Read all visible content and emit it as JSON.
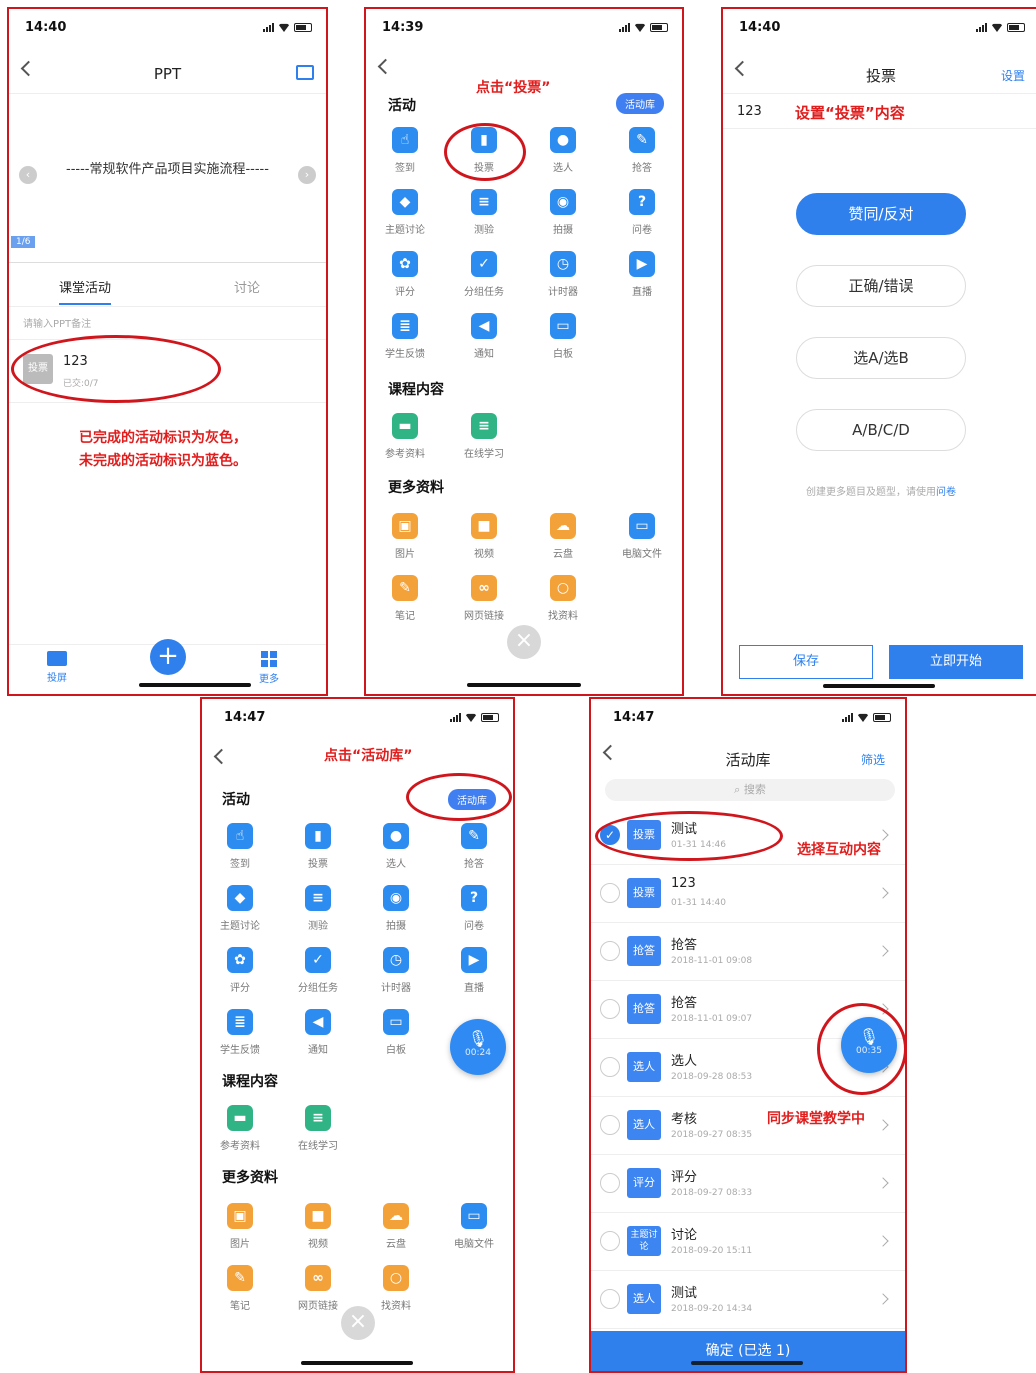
{
  "phone1": {
    "time": "14:40",
    "title": "PPT",
    "slide_text": "-----常规软件产品项目实施流程-----",
    "page_indicator": "1/6",
    "tabs": [
      "课堂活动",
      "讨论"
    ],
    "note_placeholder": "请输入PPT备注",
    "activity": {
      "tag": "投票",
      "name": "123",
      "sub": "已交:0/7"
    },
    "annotation_line1": "已完成的活动标识为灰色，",
    "annotation_line2": "未完成的活动标识为蓝色。",
    "bottom": {
      "left": "投屏",
      "right": "更多"
    }
  },
  "phone2": {
    "time": "14:39",
    "annotation": "点击“投票”",
    "library_button": "活动库",
    "section_activity": "活动",
    "activities": [
      "签到",
      "投票",
      "选人",
      "抢答",
      "主题讨论",
      "测验",
      "拍摄",
      "问卷",
      "评分",
      "分组任务",
      "计时器",
      "直播",
      "学生反馈",
      "通知",
      "白板"
    ],
    "section_course": "课程内容",
    "course_items": [
      "参考资料",
      "在线学习"
    ],
    "section_more": "更多资料",
    "more_items": [
      "图片",
      "视频",
      "云盘",
      "电脑文件",
      "笔记",
      "网页链接",
      "找资料"
    ]
  },
  "phone3": {
    "time": "14:40",
    "title": "投票",
    "settings": "设置",
    "input_value": "123",
    "annotation": "设置“投票”内容",
    "options": [
      "赞同/反对",
      "正确/错误",
      "选A/选B",
      "A/B/C/D"
    ],
    "hint_prefix": "创建更多题目及题型，请使用",
    "hint_link": "问卷",
    "save": "保存",
    "start": "立即开始"
  },
  "phone4": {
    "time": "14:47",
    "annotation": "点击“活动库”",
    "mic_time": "00:24",
    "more_items_partial": [
      "笔记",
      "网页链接",
      "找资料"
    ]
  },
  "phone5": {
    "time": "14:47",
    "title": "活动库",
    "filter": "筛选",
    "search_placeholder": "搜索",
    "annotation_select": "选择互动内容",
    "annotation_sync": "同步课堂教学中",
    "mic_time": "00:35",
    "rows": [
      {
        "tag": "投票",
        "name": "测试",
        "date": "01-31 14:46",
        "checked": true
      },
      {
        "tag": "投票",
        "name": "123",
        "date": "01-31 14:40",
        "checked": false
      },
      {
        "tag": "抢答",
        "name": "抢答",
        "date": "2018-11-01 09:08",
        "checked": false
      },
      {
        "tag": "抢答",
        "name": "抢答",
        "date": "2018-11-01 09:07",
        "checked": false
      },
      {
        "tag": "选人",
        "name": "选人",
        "date": "2018-09-28 08:53",
        "checked": false
      },
      {
        "tag": "选人",
        "name": "考核",
        "date": "2018-09-27 08:35",
        "checked": false
      },
      {
        "tag": "评分",
        "name": "评分",
        "date": "2018-09-27 08:33",
        "checked": false
      },
      {
        "tag": "主题讨论",
        "name": "讨论",
        "date": "2018-09-20 15:11",
        "checked": false
      },
      {
        "tag": "选人",
        "name": "测试",
        "date": "2018-09-20 14:34",
        "checked": false
      }
    ],
    "confirm": "确定 (已选 1)"
  }
}
